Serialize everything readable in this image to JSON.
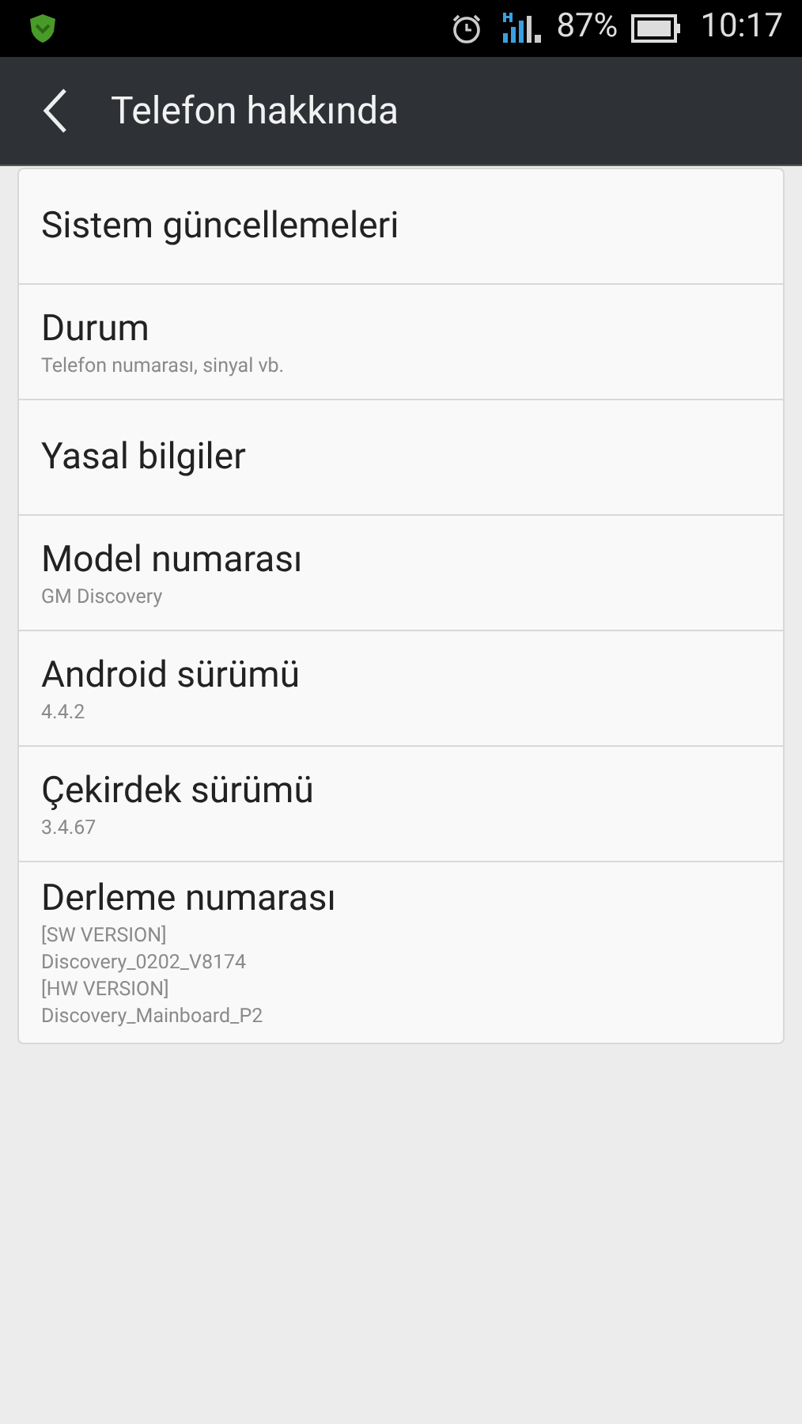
{
  "status_bar": {
    "battery_text": "87%",
    "time": "10:17"
  },
  "app_bar": {
    "title": "Telefon hakkında"
  },
  "items": [
    {
      "title": "Sistem güncellemeleri"
    },
    {
      "title": "Durum",
      "summary": [
        "Telefon numarası, sinyal vb."
      ]
    },
    {
      "title": "Yasal bilgiler"
    },
    {
      "title": "Model numarası",
      "summary": [
        "GM Discovery"
      ]
    },
    {
      "title": "Android sürümü",
      "summary": [
        "4.4.2"
      ]
    },
    {
      "title": "Çekirdek sürümü",
      "summary": [
        "3.4.67"
      ]
    },
    {
      "title": "Derleme numarası",
      "summary": [
        "[SW VERSION]",
        "Discovery_0202_V8174",
        "[HW VERSION]",
        "Discovery_Mainboard_P2"
      ]
    }
  ]
}
